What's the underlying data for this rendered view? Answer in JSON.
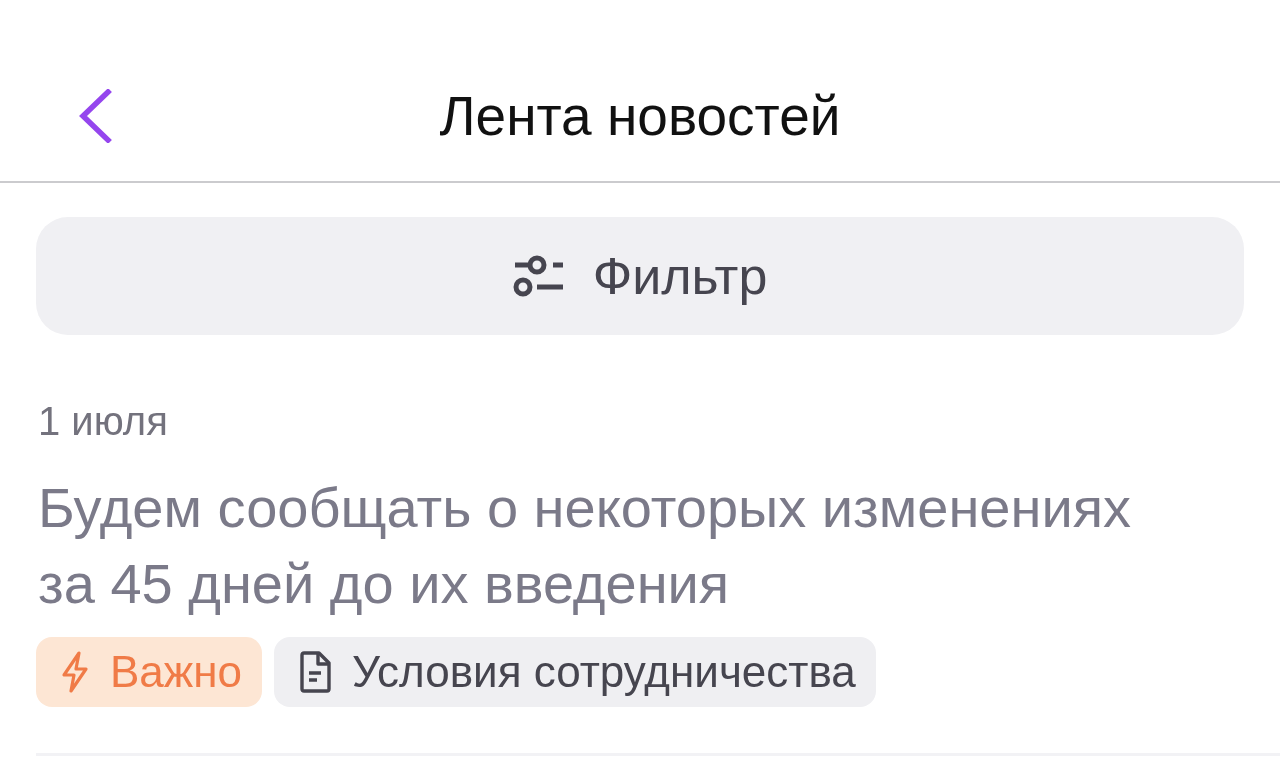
{
  "header": {
    "title": "Лента новостей"
  },
  "filter_button": {
    "label": "Фильтр"
  },
  "news": [
    {
      "date": "1 июля",
      "headline": "Будем сообщать о некоторых изменениях за 45 дней до их введения",
      "tags": [
        {
          "kind": "important",
          "label": "Важно"
        },
        {
          "kind": "category",
          "label": "Условия сотрудничества"
        }
      ]
    }
  ]
}
